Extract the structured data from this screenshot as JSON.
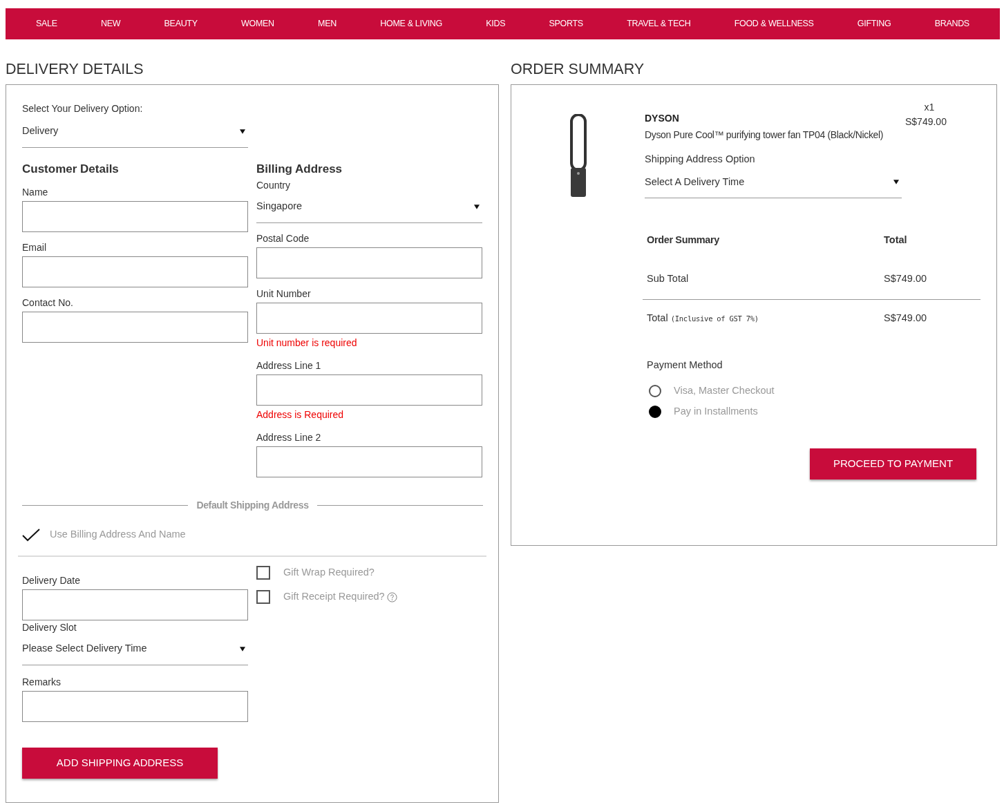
{
  "nav": [
    "SALE",
    "NEW",
    "BEAUTY",
    "WOMEN",
    "MEN",
    "HOME & LIVING",
    "KIDS",
    "SPORTS",
    "TRAVEL & TECH",
    "FOOD & WELLNESS",
    "GIFTING",
    "BRANDS"
  ],
  "delivery": {
    "heading": "DELIVERY DETAILS",
    "option_label": "Select Your Delivery Option:",
    "option_value": "Delivery",
    "customer": {
      "heading": "Customer Details",
      "fields": [
        {
          "label": "Name"
        },
        {
          "label": "Email"
        },
        {
          "label": "Contact No."
        }
      ]
    },
    "billing": {
      "heading": "Billing Address",
      "country": {
        "label": "Country",
        "value": "Singapore"
      },
      "fields": [
        {
          "label": "Postal Code"
        },
        {
          "label": "Unit Number",
          "error": "Unit number is required"
        },
        {
          "label": "Address Line 1",
          "error": "Address is Required"
        },
        {
          "label": "Address Line 2"
        }
      ]
    },
    "divider_label": "Default Shipping Address",
    "use_billing": {
      "label": "Use Billing Address And Name",
      "checked": true
    },
    "delivery_date": {
      "label": "Delivery Date"
    },
    "delivery_slot": {
      "label": "Delivery Slot",
      "value": "Please Select Delivery Time"
    },
    "remarks": {
      "label": "Remarks"
    },
    "gift_options": [
      {
        "label": "Gift Wrap Required?",
        "checked": false,
        "help": false
      },
      {
        "label": "Gift Receipt Required?",
        "checked": false,
        "help": true
      }
    ],
    "button": "ADD SHIPPING ADDRESS"
  },
  "order": {
    "heading": "ORDER SUMMARY",
    "product": {
      "brand": "DYSON",
      "name": "Dyson Pure Cool™ purifying tower fan TP04 (Black/Nickel)",
      "quantity": "x1",
      "price": "S$749.00"
    },
    "shipping_label": "Shipping Address Option",
    "shipping_value": "Select A Delivery Time",
    "summary_heading": "Order Summary",
    "total_heading": "Total",
    "sub_total": {
      "label": "Sub Total",
      "value": "S$749.00"
    },
    "total": {
      "label": "Total",
      "note": "(Inclusive of GST 7%)",
      "value": "S$749.00"
    },
    "payment": {
      "label": "Payment Method",
      "options": [
        {
          "label": "Visa, Master Checkout",
          "selected": false
        },
        {
          "label": "Pay in Installments",
          "selected": true
        }
      ]
    },
    "button": "PROCEED TO PAYMENT"
  }
}
